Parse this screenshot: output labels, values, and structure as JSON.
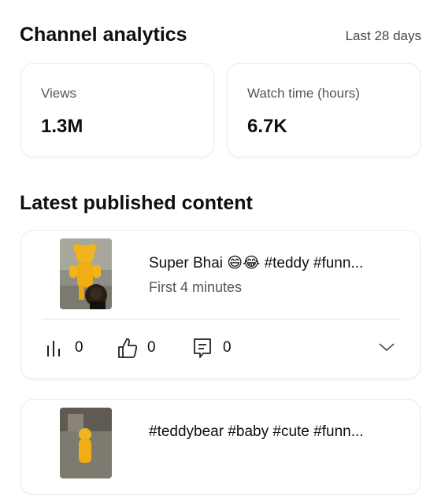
{
  "header": {
    "title": "Channel analytics",
    "period": "Last 28 days"
  },
  "stats": [
    {
      "label": "Views",
      "value": "1.3M"
    },
    {
      "label": "Watch time (hours)",
      "value": "6.7K"
    }
  ],
  "latest": {
    "section_title": "Latest published content",
    "items": [
      {
        "title": "Super Bhai 😄😂 #teddy #funn...",
        "subtitle": "First 4 minutes",
        "views": "0",
        "likes": "0",
        "comments": "0"
      },
      {
        "title": "#teddybear #baby #cute #funn..."
      }
    ]
  },
  "icons": {
    "views": "bar-chart-icon",
    "likes": "thumbs-up-icon",
    "comments": "comment-icon",
    "expand": "chevron-down-icon"
  }
}
